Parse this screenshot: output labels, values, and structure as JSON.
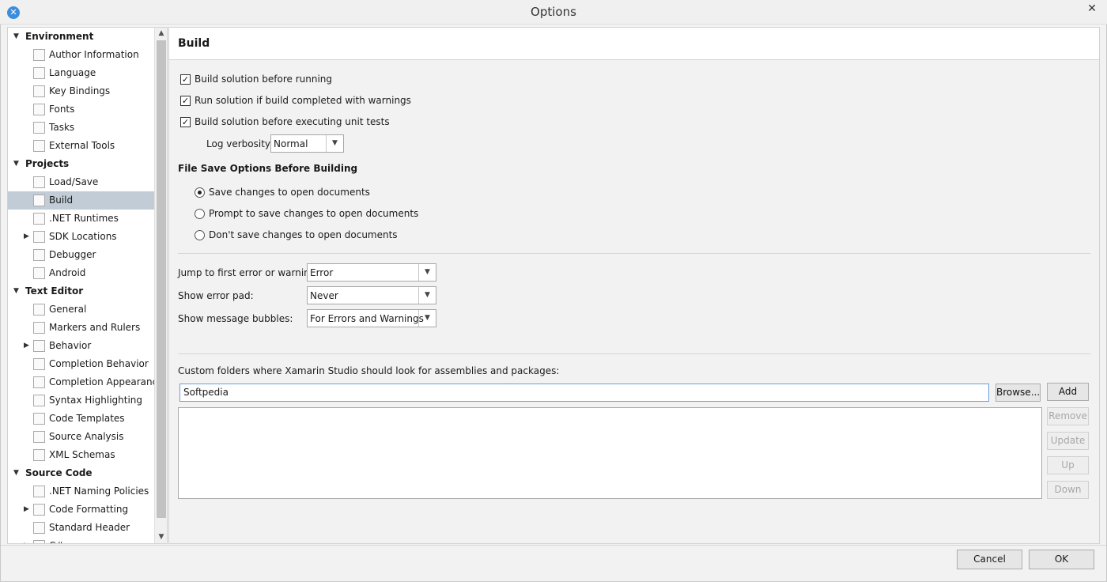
{
  "window": {
    "title": "Options",
    "app_icon": "xamarin-icon",
    "close_glyph": "✕"
  },
  "sidebar": {
    "selected": "Build",
    "categories": [
      {
        "label": "Environment",
        "items": [
          {
            "label": "Author Information",
            "icon": "author-icon"
          },
          {
            "label": "Language",
            "icon": "language-icon"
          },
          {
            "label": "Key Bindings",
            "icon": "key-icon"
          },
          {
            "label": "Fonts",
            "icon": "fonts-icon"
          },
          {
            "label": "Tasks",
            "icon": "tasks-icon"
          },
          {
            "label": "External Tools",
            "icon": "terminal-icon"
          }
        ]
      },
      {
        "label": "Projects",
        "items": [
          {
            "label": "Load/Save",
            "icon": "load-save-icon"
          },
          {
            "label": "Build",
            "icon": "build-icon"
          },
          {
            "label": ".NET Runtimes",
            "icon": "gear-icon"
          },
          {
            "label": "SDK Locations",
            "icon": "folder-icon",
            "expandable": true
          },
          {
            "label": "Debugger",
            "icon": "bug-icon"
          },
          {
            "label": "Android",
            "icon": "android-icon"
          }
        ]
      },
      {
        "label": "Text Editor",
        "items": [
          {
            "label": "General",
            "icon": "general-icon"
          },
          {
            "label": "Markers and Rulers",
            "icon": "markers-icon"
          },
          {
            "label": "Behavior",
            "icon": "brain-icon",
            "expandable": true
          },
          {
            "label": "Completion Behavior",
            "icon": "list-icon"
          },
          {
            "label": "Completion Appearance",
            "icon": "list-icon"
          },
          {
            "label": "Syntax Highlighting",
            "icon": "syntax-icon"
          },
          {
            "label": "Code Templates",
            "icon": "template-icon"
          },
          {
            "label": "Source Analysis",
            "icon": "bulb-icon"
          },
          {
            "label": "XML Schemas",
            "icon": "xml-icon"
          }
        ]
      },
      {
        "label": "Source Code",
        "items": [
          {
            "label": ".NET Naming Policies",
            "icon": "naming-icon"
          },
          {
            "label": "Code Formatting",
            "icon": "format-icon",
            "expandable": true
          },
          {
            "label": "Standard Header",
            "icon": "header-icon"
          },
          {
            "label": "C#",
            "icon": "csharp-icon",
            "expandable": true
          }
        ]
      }
    ]
  },
  "main": {
    "title": "Build",
    "checkboxes": [
      {
        "label": "Build solution before running",
        "checked": true
      },
      {
        "label": "Run solution if build completed with warnings",
        "checked": true
      },
      {
        "label": "Build solution before executing unit tests",
        "checked": true
      }
    ],
    "log_verbosity": {
      "label": "Log verbosity:",
      "value": "Normal"
    },
    "file_save": {
      "title": "File Save Options Before Building",
      "options": [
        {
          "label": "Save changes to open documents",
          "selected": true
        },
        {
          "label": "Prompt to save changes to open documents",
          "selected": false
        },
        {
          "label": "Don't save changes to open documents",
          "selected": false
        }
      ]
    },
    "jump_to_error": {
      "label": "Jump to first error or warning:",
      "value": "Error"
    },
    "show_error_pad": {
      "label": "Show error pad:",
      "value": "Never"
    },
    "show_message_bubbles": {
      "label": "Show message bubbles:",
      "value": "For Errors and Warnings"
    },
    "custom_folders": {
      "label": "Custom folders where Xamarin Studio should look for assemblies and packages:",
      "input_value": "Softpedia",
      "browse_label": "Browse...",
      "add_label": "Add",
      "remove_label": "Remove",
      "update_label": "Update",
      "up_label": "Up",
      "down_label": "Down"
    }
  },
  "footer": {
    "cancel_label": "Cancel",
    "ok_label": "OK"
  },
  "glyphs": {
    "expanded": "▼",
    "collapsed": "▶",
    "check": "✓",
    "combo_arrow": "▼",
    "scroll_up": "▲",
    "scroll_down": "▼"
  }
}
